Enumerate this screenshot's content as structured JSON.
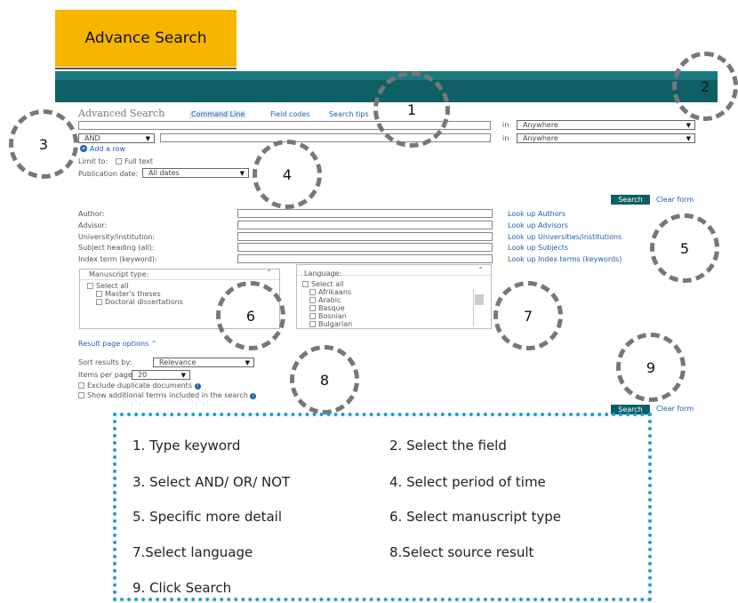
{
  "title_badge": "Advance Search",
  "form": {
    "heading": "Advanced Search",
    "tabs": [
      "Command Line",
      "Field codes",
      "Search tips"
    ],
    "row1_in": "in",
    "row1_field": "Anywhere",
    "row2_operator": "AND",
    "row2_in": "in",
    "row2_field": "Anywhere",
    "add_row": "Add a row",
    "limit_to": "Limit to:",
    "full_text": "Full text",
    "pub_date_label": "Publication date:",
    "pub_date_value": "All dates",
    "search_label": "Search",
    "clear_form": "Clear form",
    "fields": [
      {
        "label": "Author:",
        "lookup": "Look up Authors"
      },
      {
        "label": "Advisor:",
        "lookup": "Look up Advisors"
      },
      {
        "label": "University/institution:",
        "lookup": "Look up Universities/institutions"
      },
      {
        "label": "Subject heading (all):",
        "lookup": "Look up Subjects"
      },
      {
        "label": "Index term (keyword):",
        "lookup": "Look up Index terms (keywords)"
      }
    ],
    "manuscript": {
      "title": "Manuscript type:",
      "select_all": "Select all",
      "items": [
        "Master's theses",
        "Doctoral dissertations"
      ]
    },
    "language": {
      "title": "Language:",
      "select_all": "Select all",
      "items": [
        "Afrikaans",
        "Arabic",
        "Basque",
        "Bosnian",
        "Bulgarian"
      ]
    },
    "result_options": "Result page options",
    "sort_label": "Sort results by:",
    "sort_value": "Relevance",
    "items_label": "Items per page:",
    "items_value": "20",
    "exclude_dup": "Exclude duplicate documents",
    "show_terms": "Show additional terms included in the search"
  },
  "markers": [
    "1",
    "2",
    "3",
    "4",
    "5",
    "6",
    "7",
    "8",
    "9"
  ],
  "legend": {
    "items": [
      "1. Type keyword",
      "2. Select the field",
      "3. Select AND/ OR/ NOT",
      "4. Select period of time",
      "5. Specific more detail",
      "6. Select manuscript type",
      "7.Select language",
      "8.Select source result",
      "9. Click Search"
    ]
  },
  "colors": {
    "badge": "#f7b500",
    "header": "#0d5f63",
    "legend_border": "#1e9be0",
    "link": "#1d5fa8"
  }
}
